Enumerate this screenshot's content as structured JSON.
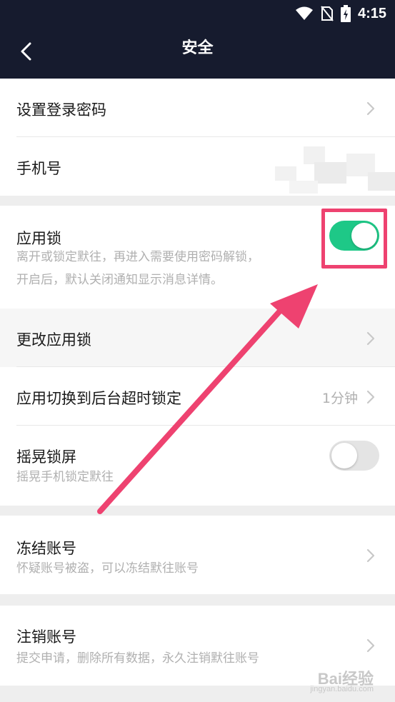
{
  "status_bar": {
    "time": "4:15",
    "icons": [
      "wifi-icon",
      "no-sim-icon",
      "battery-charging-icon"
    ]
  },
  "header": {
    "title": "安全",
    "back_icon": "chevron-left-icon"
  },
  "account_group": {
    "items": [
      {
        "label": "设置登录密码"
      },
      {
        "label": "手机号"
      }
    ]
  },
  "lock_group": {
    "app_lock": {
      "label": "应用锁",
      "sub1": "离开或锁定默往，再进入需要使用密码解锁，",
      "sub2": "开启后，默认关闭通知显示消息详情。",
      "enabled": true
    },
    "change_lock": {
      "label": "更改应用锁"
    },
    "timeout_lock": {
      "label": "应用切换到后台超时锁定",
      "value": "1分钟"
    },
    "shake_lock": {
      "label": "摇晃锁屏",
      "sub": "摇晃手机锁定默往",
      "enabled": false
    }
  },
  "freeze_group": {
    "label": "冻结账号",
    "sub": "怀疑账号被盗，可以冻结默往账号"
  },
  "cancel_group": {
    "label": "注销账号",
    "sub": "提交申请，删除所有数据，永久注销默往账号"
  },
  "watermark": {
    "text": "Bai经验",
    "sub": "jingyan.baidu.com"
  },
  "colors": {
    "header_bg": "#161b2e",
    "toggle_on": "#1ec887",
    "highlight": "#ee4270"
  }
}
